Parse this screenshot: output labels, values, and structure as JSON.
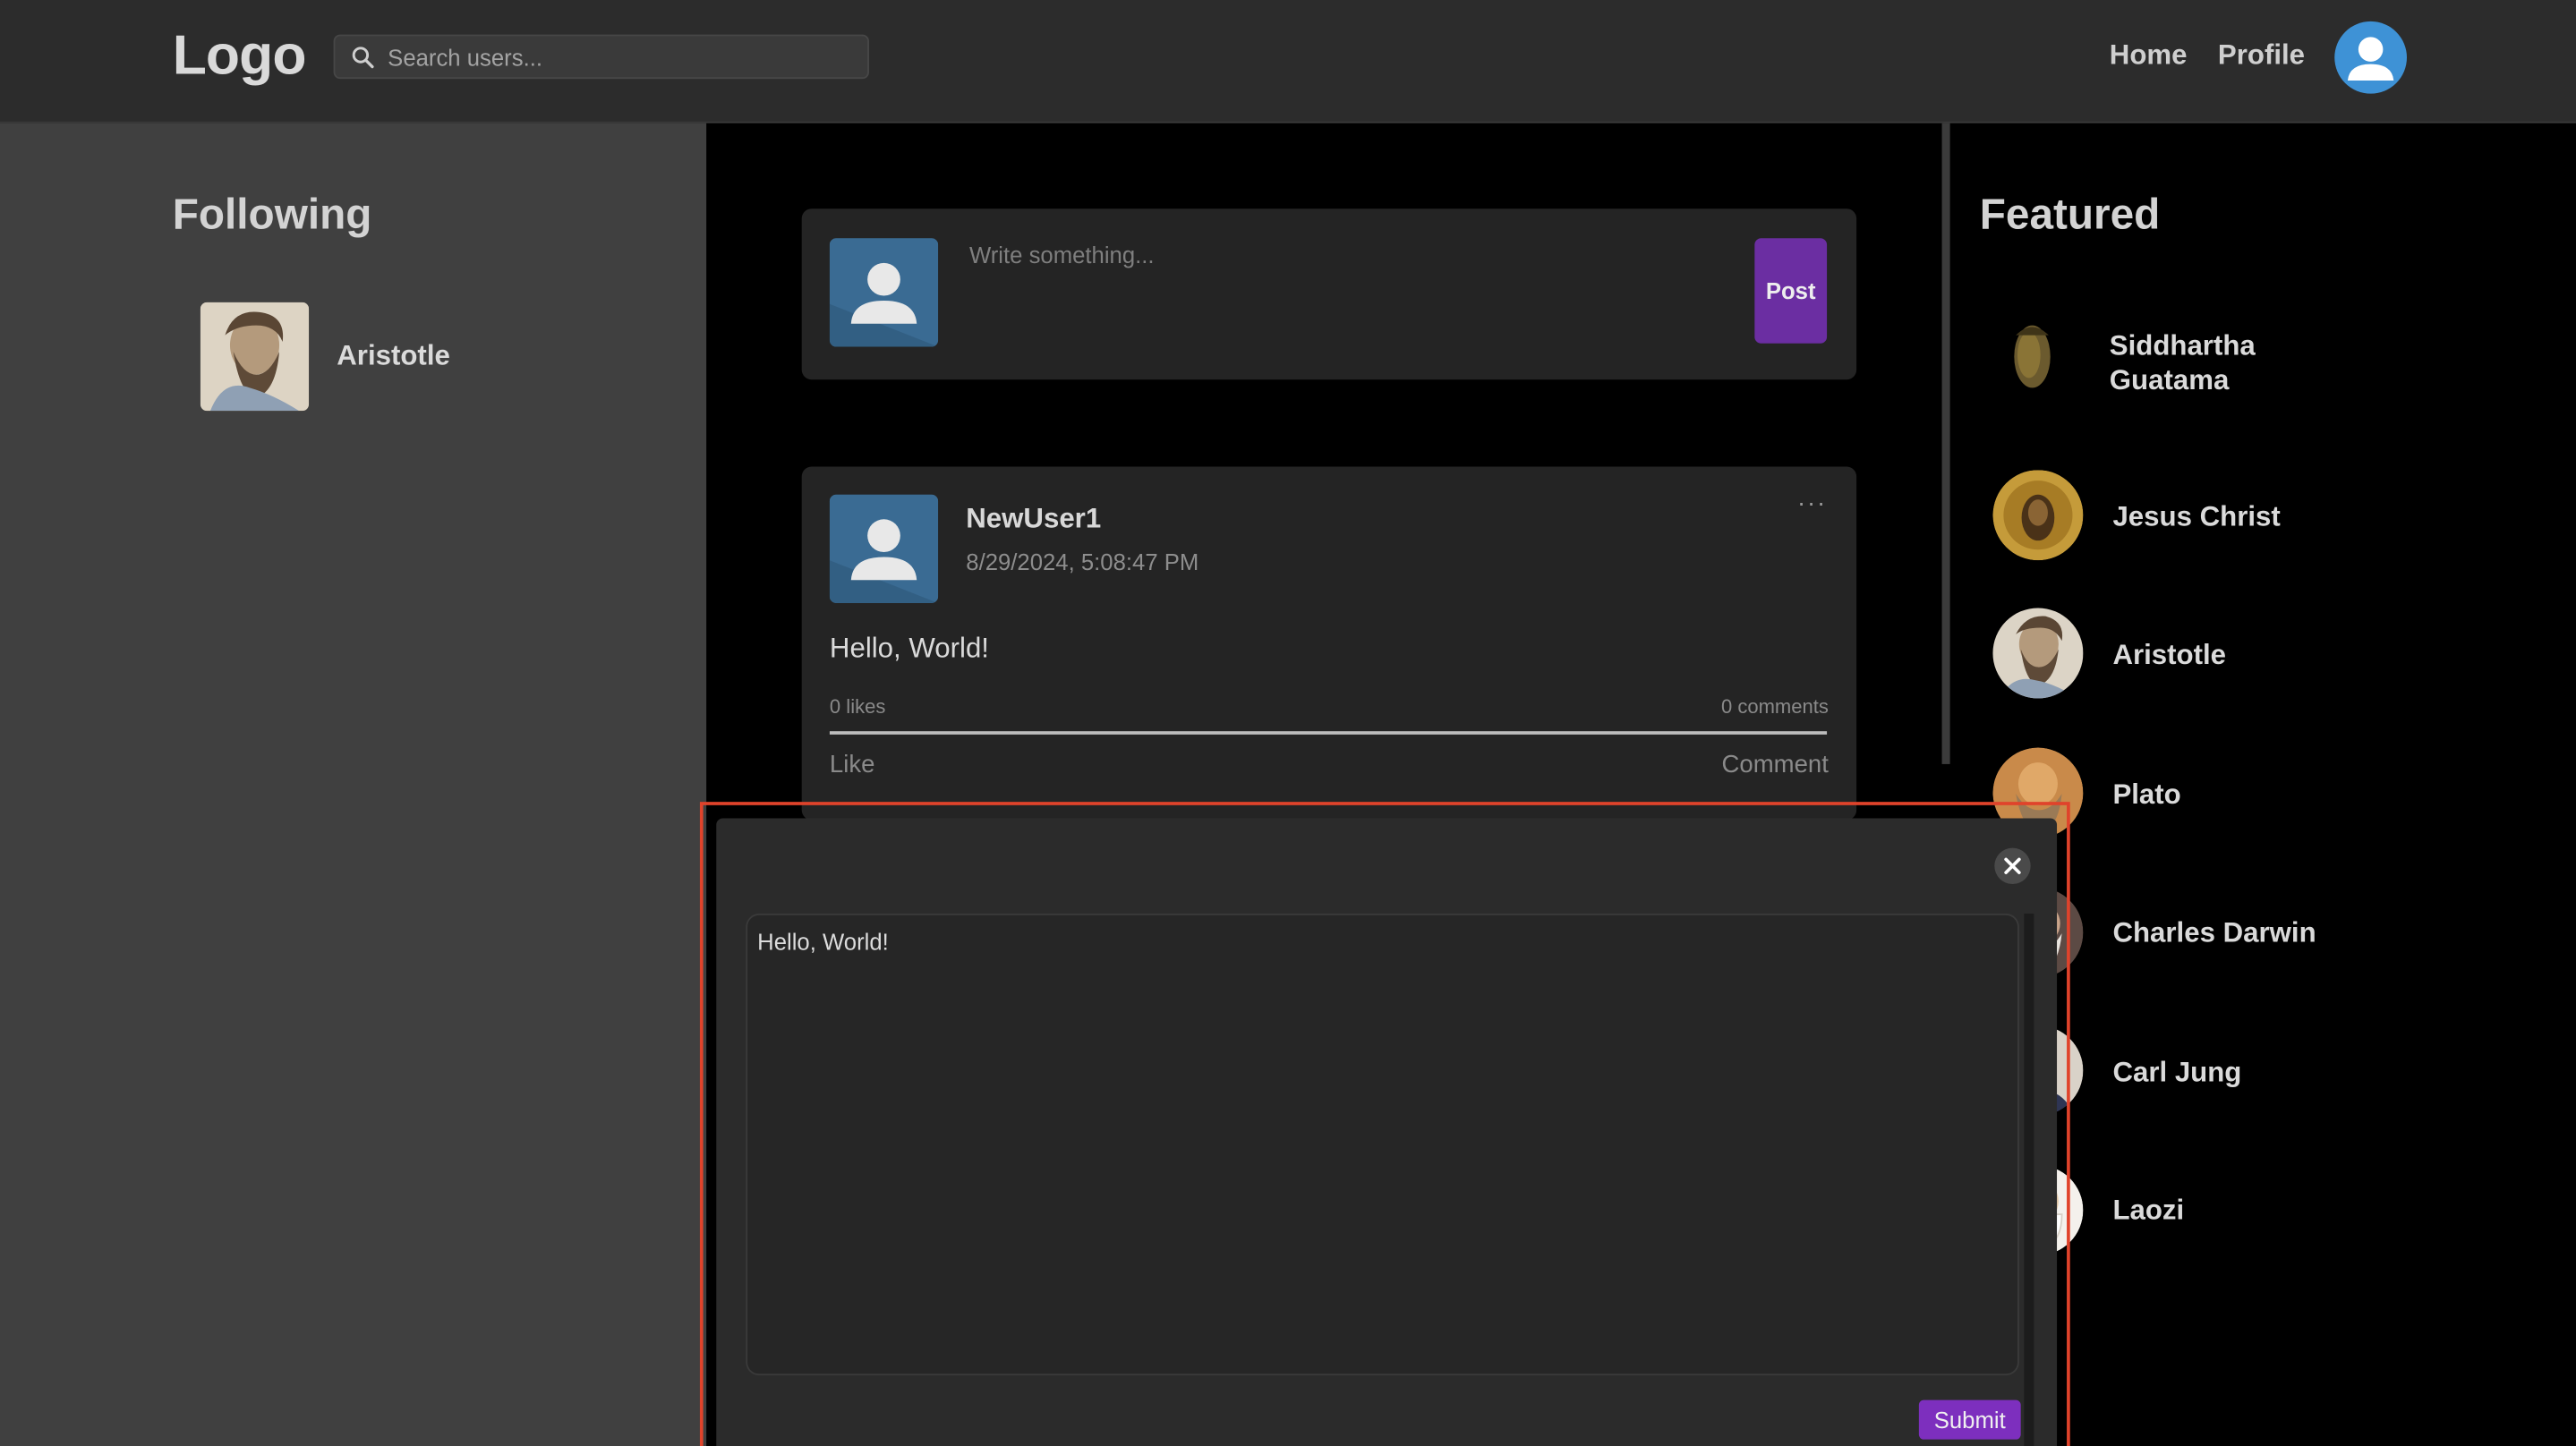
{
  "navbar": {
    "logo": "Logo",
    "search_placeholder": "Search users...",
    "links": {
      "home": "Home",
      "profile": "Profile"
    }
  },
  "following": {
    "title": "Following",
    "items": [
      {
        "name": "Aristotle"
      }
    ]
  },
  "composer": {
    "placeholder": "Write something...",
    "post_label": "Post"
  },
  "post": {
    "author": "NewUser1",
    "timestamp": "8/29/2024, 5:08:47 PM",
    "menu": "···",
    "body": "Hello, World!",
    "likes": "0 likes",
    "comments": "0 comments",
    "like_label": "Like",
    "comment_label": "Comment"
  },
  "featured": {
    "title": "Featured",
    "items": [
      {
        "name": "Siddhartha\nGuatama"
      },
      {
        "name": "Jesus Christ"
      },
      {
        "name": "Aristotle"
      },
      {
        "name": "Plato"
      },
      {
        "name": "Charles Darwin"
      },
      {
        "name": "Carl Jung"
      },
      {
        "name": "Laozi"
      }
    ]
  },
  "modal": {
    "textarea_value": "Hello, World!",
    "submit_label": "Submit"
  },
  "colors": {
    "accent": "#6b2ea2",
    "submit": "#7d2fbe",
    "highlight": "#e0432b",
    "avatar_blue": "#3e92d6"
  }
}
